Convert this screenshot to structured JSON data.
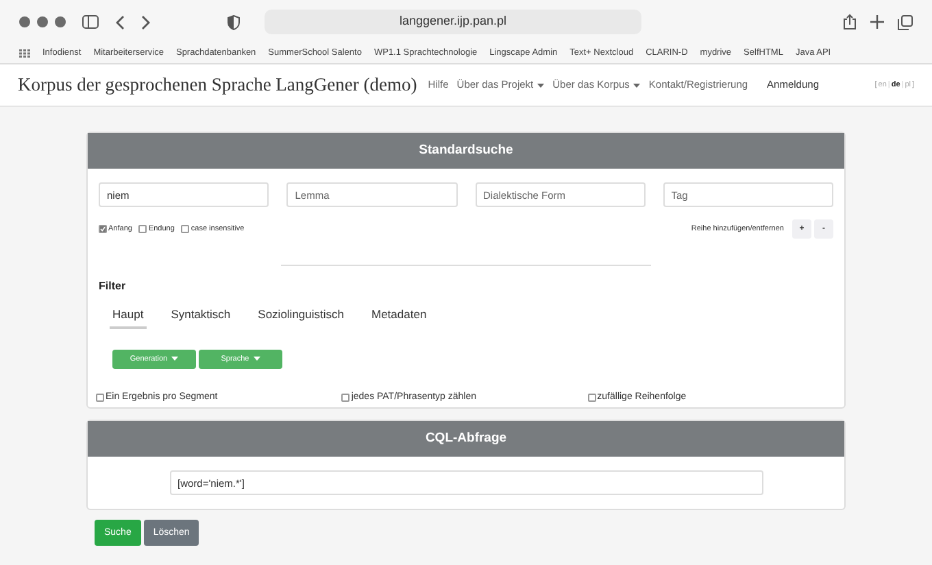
{
  "browser": {
    "url": "langgener.ijp.pan.pl",
    "bookmarks": [
      "Infodienst",
      "Mitarbeiterservice",
      "Sprachdatenbanken",
      "SummerSchool Salento",
      "WP1.1 Sprachtechnologie",
      "Lingscape Admin",
      "Text+ Nextcloud",
      "CLARIN-D",
      "mydrive",
      "SelfHTML",
      "Java API"
    ]
  },
  "navbar": {
    "title": "Korpus der gesprochenen Sprache LangGener (demo)",
    "items": [
      {
        "label": "Hilfe",
        "dropdown": false
      },
      {
        "label": "Über das Projekt",
        "dropdown": true
      },
      {
        "label": "Über das Korpus",
        "dropdown": true
      },
      {
        "label": "Kontakt/Registrierung",
        "dropdown": false
      }
    ],
    "login": "Anmeldung",
    "language_brackets": [
      "[",
      "]"
    ],
    "language_separator": "|",
    "languages": [
      {
        "label": "en",
        "selected": false
      },
      {
        "label": "de",
        "selected": true
      },
      {
        "label": "pl",
        "selected": false
      }
    ]
  },
  "search": {
    "title": "Standardsuche",
    "fields": [
      {
        "value": "niem"
      },
      {
        "placeholder": "Lemma"
      },
      {
        "placeholder": "Dialektische Form"
      },
      {
        "placeholder": "Tag"
      }
    ],
    "options": [
      {
        "label": "Anfang",
        "checked": true
      },
      {
        "label": "Endung",
        "checked": false
      },
      {
        "label": "case insensitive",
        "checked": false
      }
    ],
    "row_label": "Reihe hinzufügen/entfernen",
    "row_buttons": [
      "+",
      "-"
    ],
    "filter_label": "Filter",
    "tabs": [
      {
        "label": "Haupt",
        "selected": true
      },
      {
        "label": "Syntaktisch",
        "selected": false
      },
      {
        "label": "Soziolinguistisch",
        "selected": false
      },
      {
        "label": "Metadaten",
        "selected": false
      }
    ],
    "filter_buttons": [
      "Generation",
      "Sprache"
    ],
    "flags": [
      {
        "label": "Ein Ergebnis pro Segment",
        "checked": false
      },
      {
        "label": "jedes PAT/Phrasentyp zählen",
        "checked": false
      },
      {
        "label": "zufällige Reihenfolge",
        "checked": false
      }
    ]
  },
  "cql": {
    "title": "CQL-Abfrage",
    "value": "[word='niem.*']"
  },
  "actions": [
    {
      "label": "Suche",
      "kind": "primary"
    },
    {
      "label": "Löschen",
      "kind": "secondary"
    }
  ]
}
